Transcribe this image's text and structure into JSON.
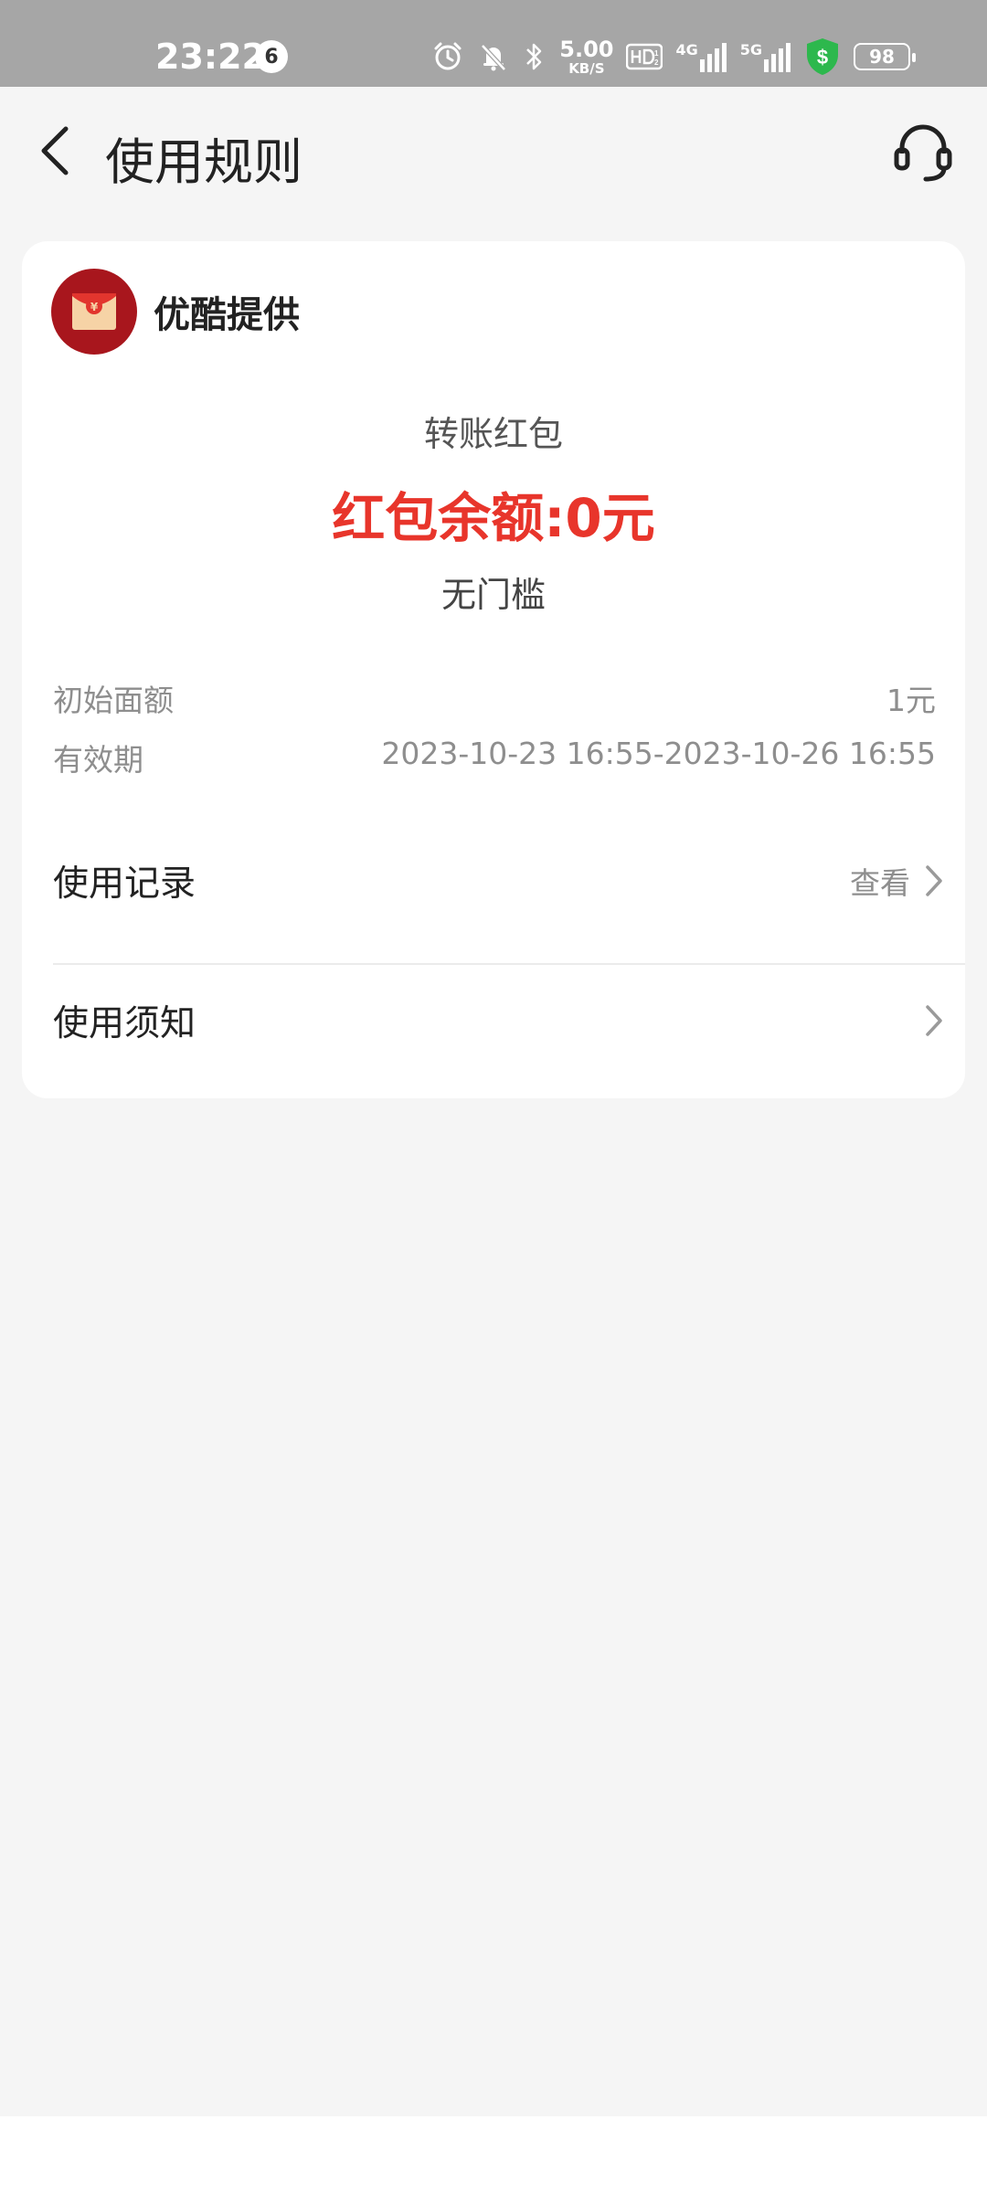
{
  "status_bar": {
    "time": "23:22",
    "notification_count": "6",
    "net_speed_value": "5.00",
    "net_speed_unit": "KB/S",
    "sig1_label": "4G",
    "sig2_label": "5G",
    "battery": "98",
    "icons": [
      "alarm-icon",
      "bell-muted-icon",
      "bluetooth-icon",
      "hd-icon",
      "signal-icon",
      "security-shield-icon",
      "battery-icon"
    ]
  },
  "header": {
    "title": "使用规则",
    "back_icon": "chevron-left-icon",
    "support_icon": "headset-icon"
  },
  "card": {
    "provider_name": "优酷提供",
    "packet_type": "转账红包",
    "balance_text": "红包余额:0元",
    "threshold": "无门槛",
    "initial_amount_label": "初始面额",
    "initial_amount_value": "1元",
    "validity_label": "有效期",
    "validity_value": "2023-10-23 16:55-2023-10-26 16:55",
    "records_label": "使用记录",
    "records_link": "查看",
    "notice_label": "使用须知"
  },
  "colors": {
    "accent_red": "#e8352b",
    "status_bar_bg": "#a6a6a6",
    "page_bg": "#f5f5f5",
    "shield_green": "#2db84d"
  }
}
